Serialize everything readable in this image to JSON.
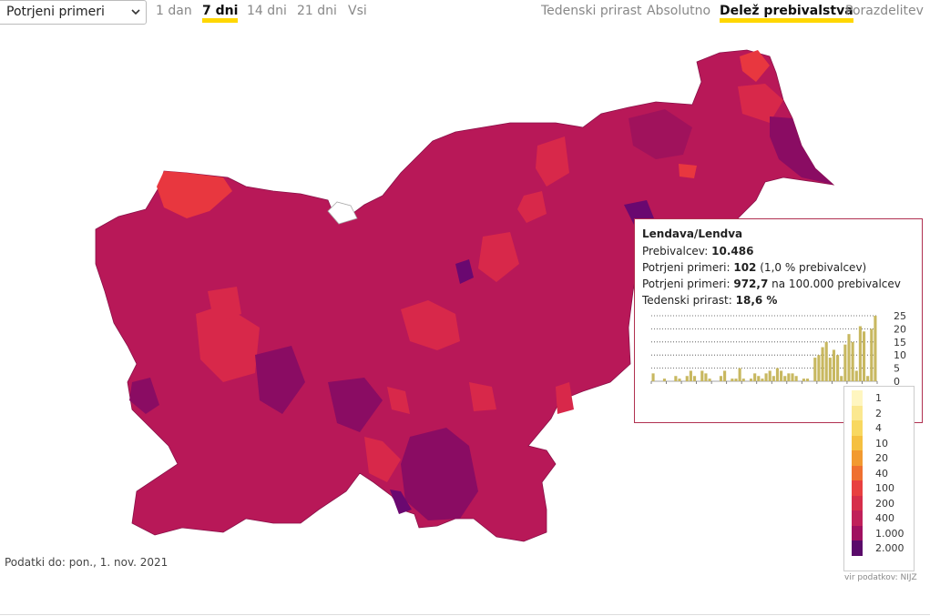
{
  "controls": {
    "metric_select": "Potrjeni primeri",
    "ranges": [
      {
        "label": "1 dan",
        "active": false
      },
      {
        "label": "7 dni",
        "active": true
      },
      {
        "label": "14 dni",
        "active": false
      },
      {
        "label": "21 dni",
        "active": false
      },
      {
        "label": "Vsi",
        "active": false
      }
    ],
    "modes": [
      {
        "label": "Tedenski prirast",
        "active": false
      },
      {
        "label": "Absolutno",
        "active": false
      },
      {
        "label": "Delež prebivalstva",
        "active": true
      },
      {
        "label": "Porazdelitev",
        "active": false
      }
    ]
  },
  "tooltip": {
    "title": "Lendava/Lendva",
    "pop_label": "Prebivalcev:",
    "pop_value": "10.486",
    "cases_label": "Potrjeni primeri:",
    "cases_value": "102",
    "cases_pct": "(1,0 % prebivalcev)",
    "per100k_label": "Potrjeni primeri:",
    "per100k_value": "972,7",
    "per100k_suffix": "na 100.000 prebivalcev",
    "growth_label": "Tedenski prirast:",
    "growth_value": "18,6 %",
    "chart": {
      "yticks": [
        "25",
        "20",
        "15",
        "10",
        "5",
        "0"
      ],
      "bar_color": "#c8b860",
      "values": [
        3,
        0,
        0,
        1,
        0,
        0,
        2,
        1,
        0,
        2,
        4,
        2,
        0,
        4,
        3,
        1,
        0,
        0,
        2,
        4,
        0,
        1,
        1,
        5,
        1,
        0,
        1,
        3,
        2,
        1,
        3,
        4,
        2,
        5,
        4,
        2,
        3,
        3,
        2,
        0,
        1,
        1,
        0,
        9,
        10,
        13,
        15,
        9,
        12,
        10,
        2,
        14,
        18,
        15,
        4,
        21,
        19,
        2,
        20,
        25
      ]
    }
  },
  "legend": {
    "labels": [
      "1",
      "2",
      "4",
      "10",
      "20",
      "40",
      "100",
      "200",
      "400",
      "1.000",
      "2.000"
    ],
    "colors": [
      "#fff6c0",
      "#fbe890",
      "#f8d860",
      "#f5c040",
      "#f29a30",
      "#ef7030",
      "#e84040",
      "#d62e4a",
      "#c0205a",
      "#a01060",
      "#5a0a6a"
    ]
  },
  "footer": {
    "date": "Podatki do: pon., 1. nov. 2021",
    "source": "vir podatkov: NIJZ"
  },
  "map": {
    "base_color": "#b81858",
    "highlight_colors": [
      "#d8284a",
      "#e8373f",
      "#8a0c63",
      "#6a0870",
      "#a0125c"
    ]
  }
}
